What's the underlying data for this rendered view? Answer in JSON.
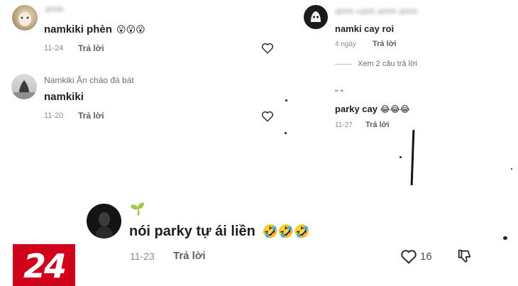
{
  "comments": [
    {
      "username": "ahhh",
      "text": "namkiki phèn",
      "emoji": "😮😮😮",
      "date": "11-24",
      "reply_label": "Trả lời"
    },
    {
      "username": "Namkiki Ăn cháo đá bát",
      "text": "namkiki",
      "date": "11-20",
      "reply_label": "Trả lời"
    },
    {
      "username": "ahhh nahh ahhh ahhh",
      "text": "namki cay roi",
      "date": "4 ngày",
      "reply_label": "Trả lời",
      "view_replies": "Xem 2 câu trả lời"
    },
    {
      "username": "\" \"",
      "text": "parky cay",
      "emoji": "😂😂😂",
      "date": "11-27",
      "reply_label": "Trả lời"
    },
    {
      "username_emoji": "🌱",
      "text": "nói parky tự ái liền",
      "emoji": "🤣🤣🤣",
      "date": "11-23",
      "reply_label": "Trả lời",
      "like_count": "16"
    }
  ],
  "logo": {
    "text": "24",
    "color": "#d0011b"
  },
  "icons": [
    "heart-icon",
    "dislike-icon"
  ]
}
